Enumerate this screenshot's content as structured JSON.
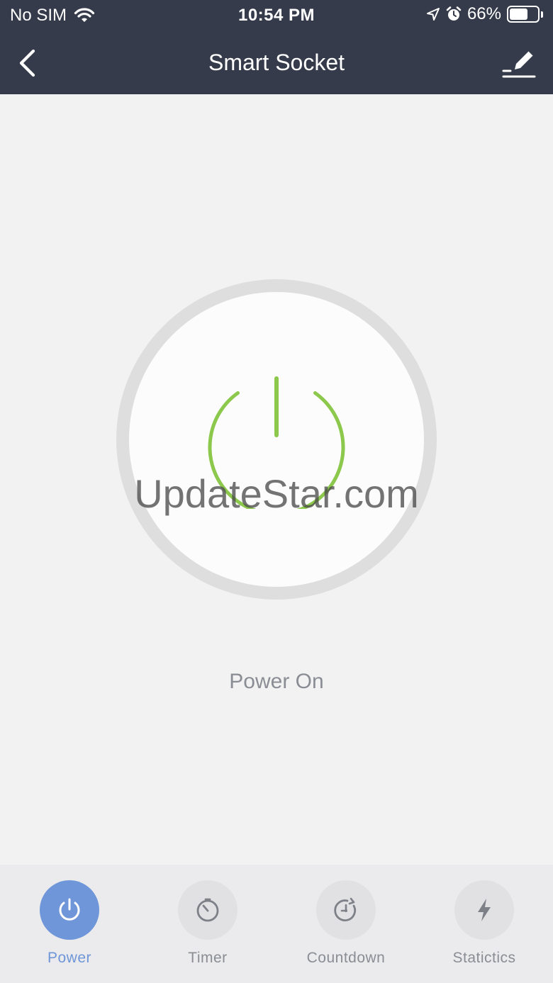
{
  "status_bar": {
    "carrier": "No SIM",
    "time": "10:54 PM",
    "battery": "66%",
    "battery_level": 0.66
  },
  "nav": {
    "title": "Smart Socket",
    "back_icon": "chevron-left-icon",
    "edit_icon": "edit-pencil-icon"
  },
  "power": {
    "state_label": "Power On",
    "icon": "power-icon",
    "icon_color": "#8cc84b"
  },
  "watermark": "UpdateStar.com",
  "tabs": [
    {
      "label": "Power",
      "icon": "power-icon",
      "active": true
    },
    {
      "label": "Timer",
      "icon": "timer-icon",
      "active": false
    },
    {
      "label": "Countdown",
      "icon": "countdown-icon",
      "active": false
    },
    {
      "label": "Statictics",
      "icon": "lightning-icon",
      "active": false
    }
  ],
  "colors": {
    "header_bg": "#353b4a",
    "accent": "#6e96d8",
    "power_green": "#8cc84b",
    "background": "#f2f2f3"
  }
}
